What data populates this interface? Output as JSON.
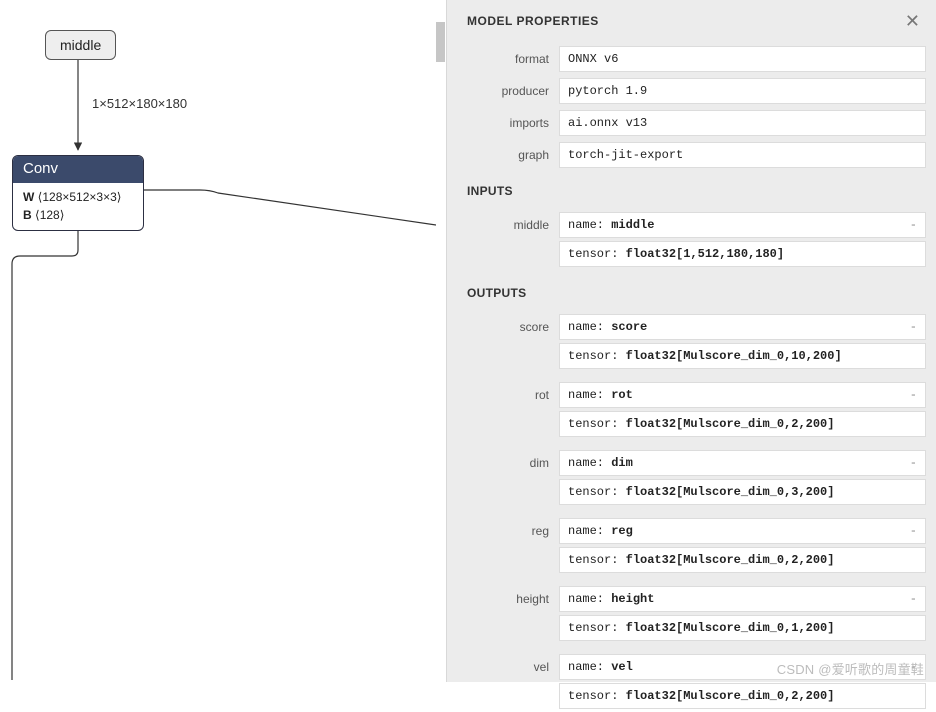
{
  "graph": {
    "input_node": "middle",
    "edge_label": "1×512×180×180",
    "op": {
      "title": "Conv",
      "W_key": "W",
      "W_shape": "⟨128×512×3×3⟩",
      "B_key": "B",
      "B_shape": "⟨128⟩"
    }
  },
  "panel": {
    "title": "MODEL PROPERTIES",
    "props": [
      {
        "label": "format",
        "value": "ONNX v6"
      },
      {
        "label": "producer",
        "value": "pytorch 1.9"
      },
      {
        "label": "imports",
        "value": "ai.onnx v13"
      },
      {
        "label": "graph",
        "value": "torch-jit-export"
      }
    ],
    "inputs_label": "INPUTS",
    "inputs": [
      {
        "label": "middle",
        "name_key": "name:",
        "name_val": "middle",
        "tensor_key": "tensor:",
        "tensor_val": "float32[1,512,180,180]"
      }
    ],
    "outputs_label": "OUTPUTS",
    "outputs": [
      {
        "label": "score",
        "name_key": "name:",
        "name_val": "score",
        "tensor_key": "tensor:",
        "tensor_val": "float32[Mulscore_dim_0,10,200]"
      },
      {
        "label": "rot",
        "name_key": "name:",
        "name_val": "rot",
        "tensor_key": "tensor:",
        "tensor_val": "float32[Mulscore_dim_0,2,200]"
      },
      {
        "label": "dim",
        "name_key": "name:",
        "name_val": "dim",
        "tensor_key": "tensor:",
        "tensor_val": "float32[Mulscore_dim_0,3,200]"
      },
      {
        "label": "reg",
        "name_key": "name:",
        "name_val": "reg",
        "tensor_key": "tensor:",
        "tensor_val": "float32[Mulscore_dim_0,2,200]"
      },
      {
        "label": "height",
        "name_key": "name:",
        "name_val": "height",
        "tensor_key": "tensor:",
        "tensor_val": "float32[Mulscore_dim_0,1,200]"
      },
      {
        "label": "vel",
        "name_key": "name:",
        "name_val": "vel",
        "tensor_key": "tensor:",
        "tensor_val": "float32[Mulscore_dim_0,2,200]"
      }
    ]
  },
  "watermark": "CSDN @爱听歌的周童鞋"
}
